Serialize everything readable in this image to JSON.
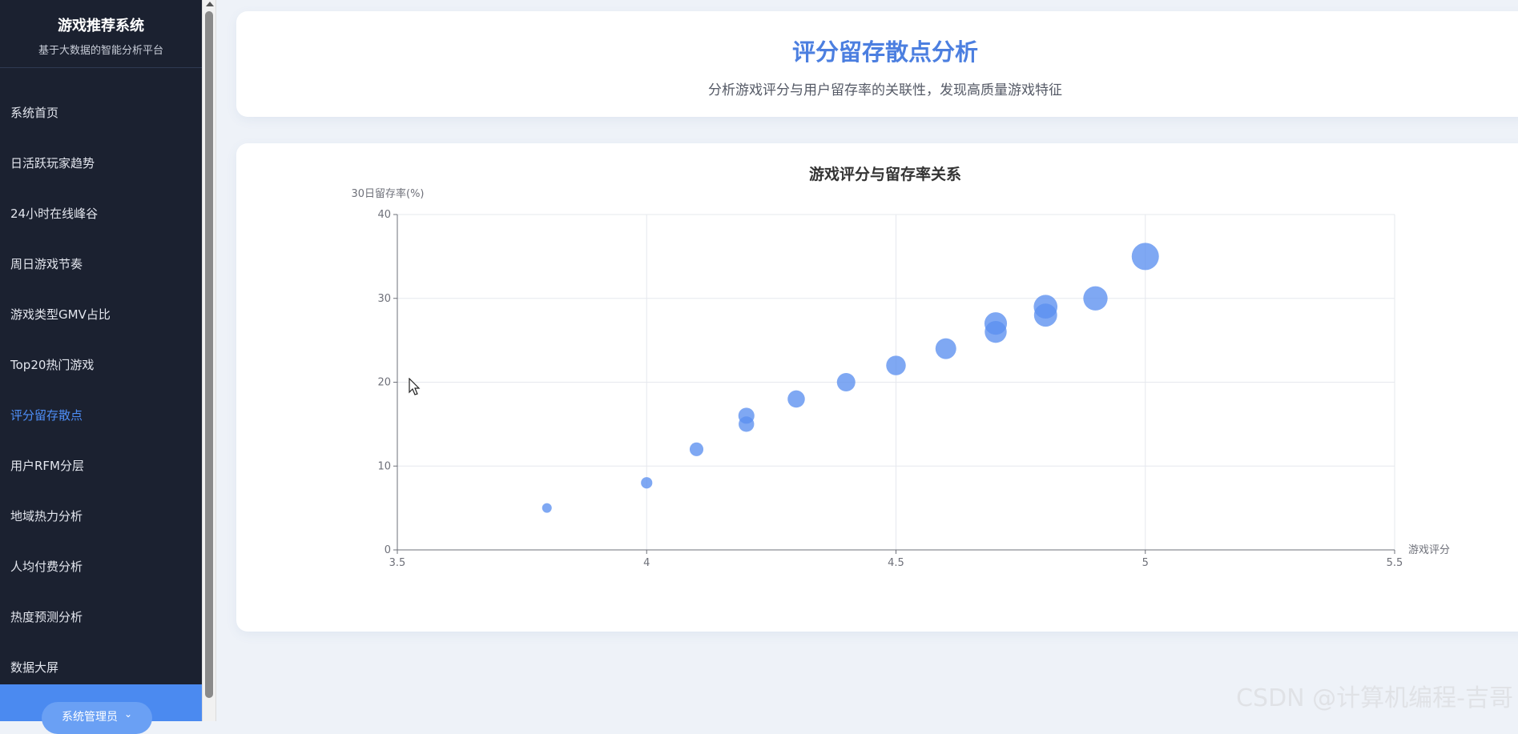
{
  "sidebar": {
    "brand_title": "游戏推荐系统",
    "brand_subtitle": "基于大数据的智能分析平台",
    "items": [
      {
        "label": "系统首页"
      },
      {
        "label": "日活跃玩家趋势"
      },
      {
        "label": "24小时在线峰谷"
      },
      {
        "label": "周日游戏节奏"
      },
      {
        "label": "游戏类型GMV占比"
      },
      {
        "label": "Top20热门游戏"
      },
      {
        "label": "评分留存散点",
        "active": true
      },
      {
        "label": "用户RFM分层"
      },
      {
        "label": "地域热力分析"
      },
      {
        "label": "人均付费分析"
      },
      {
        "label": "热度预测分析"
      },
      {
        "label": "数据大屏"
      }
    ],
    "user_label": "系统管理员",
    "accent_color": "#4e8ef7"
  },
  "header": {
    "title": "评分留存散点分析",
    "subtitle": "分析游戏评分与用户留存率的关联性，发现高质量游戏特征"
  },
  "chart_data": {
    "type": "scatter",
    "title": "游戏评分与留存率关系",
    "xlabel": "游戏评分",
    "ylabel": "30日留存率(%)",
    "xlim": [
      3.5,
      5.5
    ],
    "ylim": [
      0,
      40
    ],
    "xticks": [
      "3.5",
      "4",
      "4.5",
      "5",
      "5.5"
    ],
    "yticks": [
      "0",
      "10",
      "20",
      "30",
      "40"
    ],
    "grid": true,
    "color": "#5b8ff0",
    "points": [
      {
        "x": 3.8,
        "y": 5
      },
      {
        "x": 4.0,
        "y": 8
      },
      {
        "x": 4.1,
        "y": 12
      },
      {
        "x": 4.2,
        "y": 15
      },
      {
        "x": 4.2,
        "y": 16
      },
      {
        "x": 4.3,
        "y": 18
      },
      {
        "x": 4.4,
        "y": 20
      },
      {
        "x": 4.5,
        "y": 22
      },
      {
        "x": 4.6,
        "y": 24
      },
      {
        "x": 4.7,
        "y": 26
      },
      {
        "x": 4.7,
        "y": 27
      },
      {
        "x": 4.8,
        "y": 28
      },
      {
        "x": 4.8,
        "y": 29
      },
      {
        "x": 4.9,
        "y": 30
      },
      {
        "x": 5.0,
        "y": 35
      }
    ]
  },
  "watermark": "CSDN @计算机编程-吉哥"
}
